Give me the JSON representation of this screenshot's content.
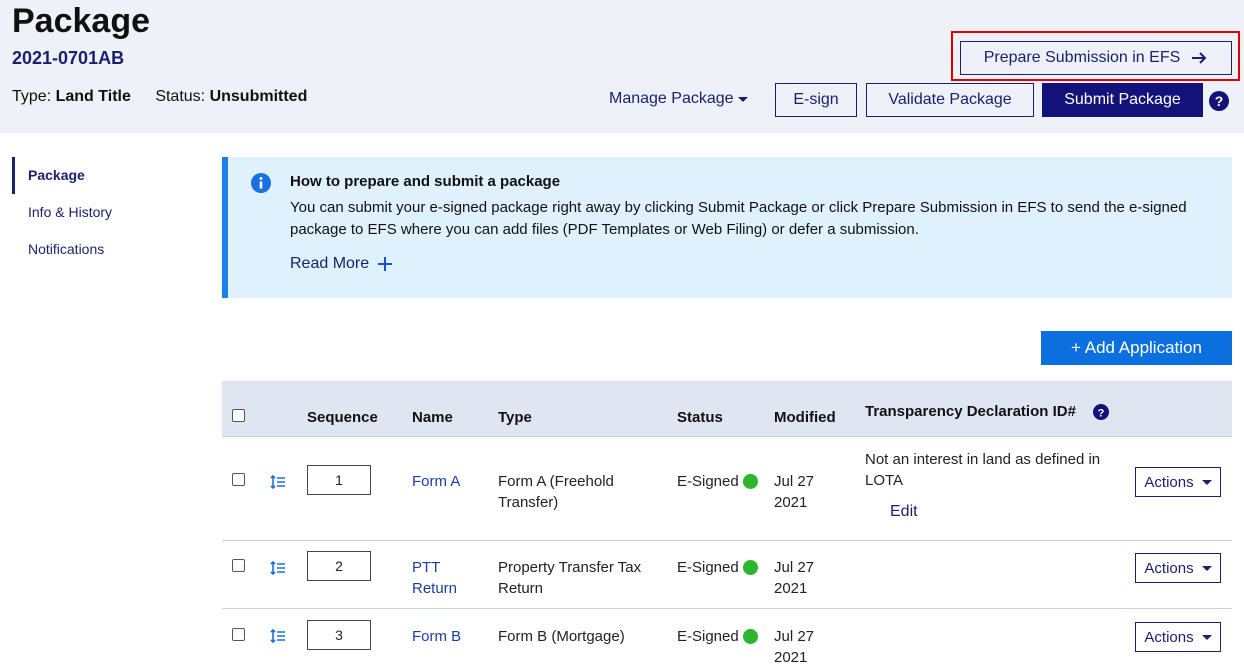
{
  "header": {
    "title": "Package",
    "package_id": "2021-0701AB",
    "type_label": "Type:",
    "type_value": "Land Title",
    "status_label": "Status:",
    "status_value": "Unsubmitted",
    "prepare_label": "Prepare Submission in EFS",
    "manage_label": "Manage Package",
    "esign_label": "E-sign",
    "validate_label": "Validate Package",
    "submit_label": "Submit Package"
  },
  "sidebar": {
    "items": [
      {
        "label": "Package",
        "active": true
      },
      {
        "label": "Info & History",
        "active": false
      },
      {
        "label": "Notifications",
        "active": false
      }
    ]
  },
  "info": {
    "title": "How to prepare and submit a package",
    "text": "You can submit your e-signed package right away by clicking Submit Package or click Prepare Submission in EFS to send the e-signed package to EFS where you can add files (PDF Templates or Web Filing) or defer a submission.",
    "read_more": "Read More"
  },
  "add_application_label": "+ Add Application",
  "table": {
    "headers": {
      "sequence": "Sequence",
      "name": "Name",
      "type": "Type",
      "status": "Status",
      "modified": "Modified",
      "transparency": "Transparency Declaration ID#"
    },
    "rows": [
      {
        "sequence": "1",
        "name": "Form A",
        "type": "Form A (Freehold Transfer)",
        "status": "E-Signed",
        "modified": "Jul 27 2021",
        "transparency": "Not an interest in land as defined in LOTA",
        "edit": "Edit",
        "actions": "Actions"
      },
      {
        "sequence": "2",
        "name": "PTT Return",
        "type": "Property Transfer Tax Return",
        "status": "E-Signed",
        "modified": "Jul 27 2021",
        "transparency": "",
        "edit": "",
        "actions": "Actions"
      },
      {
        "sequence": "3",
        "name": "Form B",
        "type": "Form B (Mortgage)",
        "status": "E-Signed",
        "modified": "Jul 27 2021",
        "transparency": "",
        "edit": "",
        "actions": "Actions"
      }
    ]
  },
  "colors": {
    "navy": "#1a1f6e",
    "header_bg": "#eef1f8",
    "info_bg": "#dff1fc",
    "info_accent": "#1b80e8",
    "add_button": "#0b6fe0",
    "status_green": "#2db52d",
    "highlight": "#e00000"
  }
}
